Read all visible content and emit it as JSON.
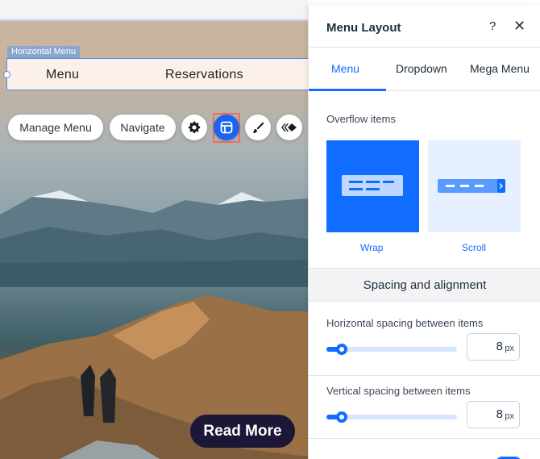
{
  "canvas": {
    "menu_tag": "Horizontal Menu",
    "menu_items": [
      "Menu",
      "Reservations"
    ],
    "toolbar": {
      "manage_menu": "Manage Menu",
      "navigate": "Navigate",
      "icons": [
        "gear-icon",
        "layout-icon",
        "paint-brush-icon",
        "animation-icon"
      ]
    },
    "read_more": "Read More"
  },
  "panel": {
    "title": "Menu Layout",
    "help_icon": "?",
    "close_icon": "✕",
    "tabs": [
      {
        "label": "Menu",
        "active": true
      },
      {
        "label": "Dropdown",
        "active": false
      },
      {
        "label": "Mega Menu",
        "active": false
      }
    ],
    "overflow": {
      "label": "Overflow items",
      "options": [
        {
          "label": "Wrap",
          "selected": true
        },
        {
          "label": "Scroll",
          "selected": false
        }
      ]
    },
    "spacing_section": "Spacing and alignment",
    "horizontal": {
      "label": "Horizontal spacing between items",
      "value": "8",
      "unit": "px",
      "fraction": 0.12
    },
    "vertical": {
      "label": "Vertical spacing between items",
      "value": "8",
      "unit": "px",
      "fraction": 0.12
    }
  },
  "colors": {
    "accent": "#116dff",
    "selected_outline": "#ef6f5e",
    "read_more_bg": "#1c1737"
  }
}
